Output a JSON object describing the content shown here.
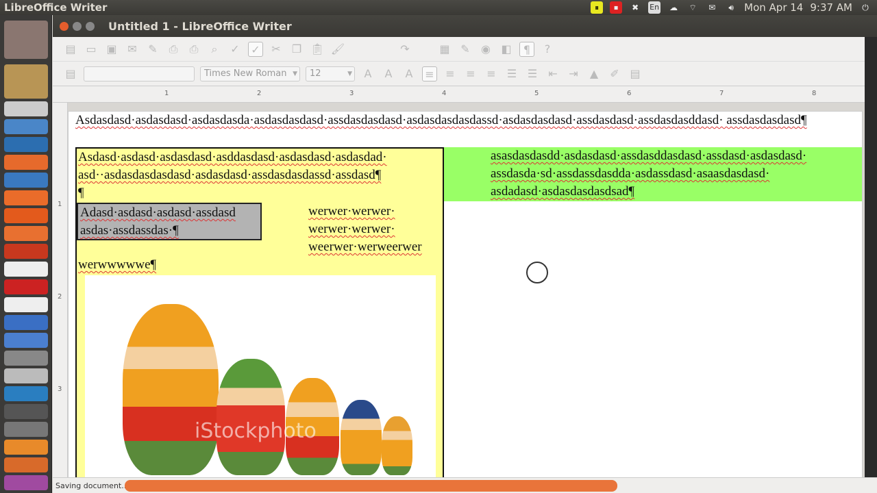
{
  "top_panel": {
    "app_name": "LibreOffice Writer",
    "keyboard": "En",
    "date": "Mon Apr 14",
    "time": "9:37 AM",
    "tray_icons": [
      "pause-record-icon",
      "stop-record-icon",
      "dropbox-icon",
      "keyboard-icon",
      "cloud-icon",
      "wifi-icon",
      "mail-icon",
      "volume-icon",
      "power-icon"
    ]
  },
  "window": {
    "title": "Untitled 1 - LibreOffice Writer"
  },
  "formatting": {
    "paragraph_style": "",
    "font_name": "Times New Roman",
    "font_size": "12"
  },
  "ruler": {
    "marks": [
      "1",
      "2",
      "3",
      "4",
      "5",
      "6",
      "7",
      "8"
    ],
    "vmarks": [
      "1",
      "2",
      "3"
    ]
  },
  "document": {
    "para1": "Asdasdasd·asdasdasd·asdasdasda·asdasdasdasd·assdasdasdasd·asdasdasdasdassd·asdasdasdasd·assdasdasd·assdasdasddasd· assdasdasdasd¶",
    "yellow_frame": {
      "para": "Asdasd·asdasd·asdasdasd·asddasdasd·asdasdasd·asdasdad· asd··asdasdasdasdasd·asdasdasd·assdasdasdassd·assdasd¶",
      "empty_para": "¶",
      "grey_box": "Adasd·asdasd·asdasd·assdasd asdas·assdassdas·¶",
      "side_text": "werwer·werwer· werwer·werwer· weerwer·werweerwer",
      "after_text": "werwwwwwe¶",
      "image_watermark": "iStockphoto"
    },
    "green_frame": "asasdasdasdd·asdasdasd·assdasddasdasd·assdasd·asdasdasd· assdasda·sd·assdassdasdda·asdassdasd·asaasdasdasd· asdadasd·asdasdasdasdsad¶"
  },
  "status": {
    "message": "Saving document...",
    "progress_percent": 66,
    "progress_color": "#e9743a"
  },
  "colors": {
    "yellow_frame": "#ffff99",
    "green_frame": "#99ff66",
    "grey_box": "#b3b3b3"
  }
}
